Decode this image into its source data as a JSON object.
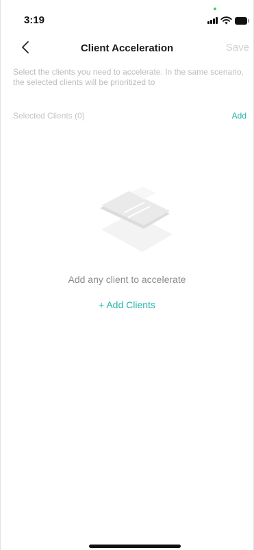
{
  "status_bar": {
    "time": "3:19",
    "icons": [
      "cellular-signal-icon",
      "wifi-icon",
      "battery-icon"
    ]
  },
  "header": {
    "title": "Client Acceleration",
    "back_icon": "chevron-left-icon",
    "save_label": "Save"
  },
  "description": "Select the clients you need to accelerate. In the same scenario, the selected clients will be prioritized to",
  "selected_section": {
    "label": "Selected Clients (0)",
    "add_label": "Add"
  },
  "empty_state": {
    "illustration_icon": "empty-list-illustration",
    "message": "Add any client to accelerate",
    "button_label": "+ Add Clients"
  },
  "colors": {
    "accent": "#1fb5a8",
    "muted_text": "#bcbcbc",
    "disabled_action": "#d0d0d0"
  }
}
